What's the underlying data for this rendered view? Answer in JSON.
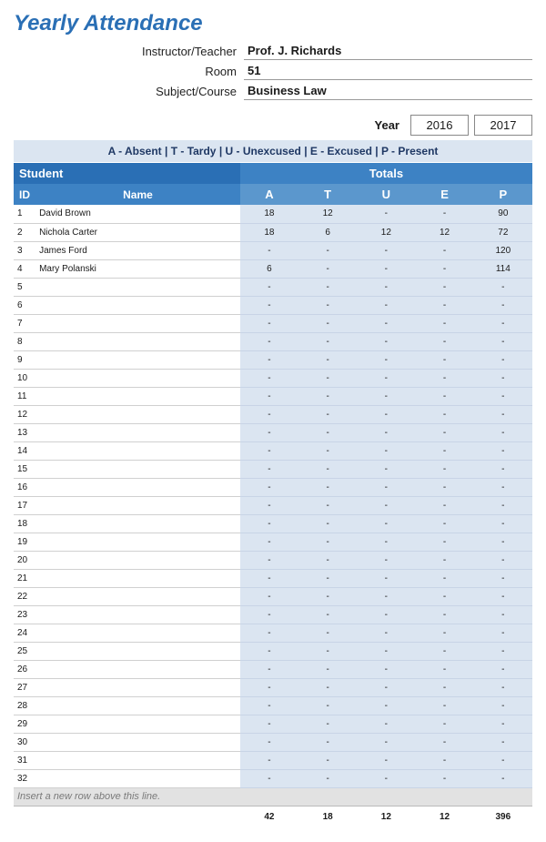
{
  "title": "Yearly Attendance",
  "meta": {
    "instructor_label": "Instructor/Teacher",
    "instructor_value": "Prof. J. Richards",
    "room_label": "Room",
    "room_value": "51",
    "subject_label": "Subject/Course",
    "subject_value": "Business Law"
  },
  "year": {
    "label": "Year",
    "y1": "2016",
    "y2": "2017"
  },
  "legend": "A - Absent  |  T - Tardy  |  U - Unexcused  |  E - Excused  |  P - Present",
  "headers": {
    "student": "Student",
    "totals": "Totals",
    "id": "ID",
    "name": "Name",
    "cols": [
      "A",
      "T",
      "U",
      "E",
      "P"
    ]
  },
  "rows": [
    {
      "id": "1",
      "name": "David Brown",
      "a": "18",
      "t": "12",
      "u": "-",
      "e": "-",
      "p": "90"
    },
    {
      "id": "2",
      "name": "Nichola Carter",
      "a": "18",
      "t": "6",
      "u": "12",
      "e": "12",
      "p": "72"
    },
    {
      "id": "3",
      "name": "James Ford",
      "a": "-",
      "t": "-",
      "u": "-",
      "e": "-",
      "p": "120"
    },
    {
      "id": "4",
      "name": "Mary Polanski",
      "a": "6",
      "t": "-",
      "u": "-",
      "e": "-",
      "p": "114"
    },
    {
      "id": "5",
      "name": "",
      "a": "-",
      "t": "-",
      "u": "-",
      "e": "-",
      "p": "-"
    },
    {
      "id": "6",
      "name": "",
      "a": "-",
      "t": "-",
      "u": "-",
      "e": "-",
      "p": "-"
    },
    {
      "id": "7",
      "name": "",
      "a": "-",
      "t": "-",
      "u": "-",
      "e": "-",
      "p": "-"
    },
    {
      "id": "8",
      "name": "",
      "a": "-",
      "t": "-",
      "u": "-",
      "e": "-",
      "p": "-"
    },
    {
      "id": "9",
      "name": "",
      "a": "-",
      "t": "-",
      "u": "-",
      "e": "-",
      "p": "-"
    },
    {
      "id": "10",
      "name": "",
      "a": "-",
      "t": "-",
      "u": "-",
      "e": "-",
      "p": "-"
    },
    {
      "id": "11",
      "name": "",
      "a": "-",
      "t": "-",
      "u": "-",
      "e": "-",
      "p": "-"
    },
    {
      "id": "12",
      "name": "",
      "a": "-",
      "t": "-",
      "u": "-",
      "e": "-",
      "p": "-"
    },
    {
      "id": "13",
      "name": "",
      "a": "-",
      "t": "-",
      "u": "-",
      "e": "-",
      "p": "-"
    },
    {
      "id": "14",
      "name": "",
      "a": "-",
      "t": "-",
      "u": "-",
      "e": "-",
      "p": "-"
    },
    {
      "id": "15",
      "name": "",
      "a": "-",
      "t": "-",
      "u": "-",
      "e": "-",
      "p": "-"
    },
    {
      "id": "16",
      "name": "",
      "a": "-",
      "t": "-",
      "u": "-",
      "e": "-",
      "p": "-"
    },
    {
      "id": "17",
      "name": "",
      "a": "-",
      "t": "-",
      "u": "-",
      "e": "-",
      "p": "-"
    },
    {
      "id": "18",
      "name": "",
      "a": "-",
      "t": "-",
      "u": "-",
      "e": "-",
      "p": "-"
    },
    {
      "id": "19",
      "name": "",
      "a": "-",
      "t": "-",
      "u": "-",
      "e": "-",
      "p": "-"
    },
    {
      "id": "20",
      "name": "",
      "a": "-",
      "t": "-",
      "u": "-",
      "e": "-",
      "p": "-"
    },
    {
      "id": "21",
      "name": "",
      "a": "-",
      "t": "-",
      "u": "-",
      "e": "-",
      "p": "-"
    },
    {
      "id": "22",
      "name": "",
      "a": "-",
      "t": "-",
      "u": "-",
      "e": "-",
      "p": "-"
    },
    {
      "id": "23",
      "name": "",
      "a": "-",
      "t": "-",
      "u": "-",
      "e": "-",
      "p": "-"
    },
    {
      "id": "24",
      "name": "",
      "a": "-",
      "t": "-",
      "u": "-",
      "e": "-",
      "p": "-"
    },
    {
      "id": "25",
      "name": "",
      "a": "-",
      "t": "-",
      "u": "-",
      "e": "-",
      "p": "-"
    },
    {
      "id": "26",
      "name": "",
      "a": "-",
      "t": "-",
      "u": "-",
      "e": "-",
      "p": "-"
    },
    {
      "id": "27",
      "name": "",
      "a": "-",
      "t": "-",
      "u": "-",
      "e": "-",
      "p": "-"
    },
    {
      "id": "28",
      "name": "",
      "a": "-",
      "t": "-",
      "u": "-",
      "e": "-",
      "p": "-"
    },
    {
      "id": "29",
      "name": "",
      "a": "-",
      "t": "-",
      "u": "-",
      "e": "-",
      "p": "-"
    },
    {
      "id": "30",
      "name": "",
      "a": "-",
      "t": "-",
      "u": "-",
      "e": "-",
      "p": "-"
    },
    {
      "id": "31",
      "name": "",
      "a": "-",
      "t": "-",
      "u": "-",
      "e": "-",
      "p": "-"
    },
    {
      "id": "32",
      "name": "",
      "a": "-",
      "t": "-",
      "u": "-",
      "e": "-",
      "p": "-"
    }
  ],
  "insert_hint": "Insert a new row above this line.",
  "grand_totals": {
    "a": "42",
    "t": "18",
    "u": "12",
    "e": "12",
    "p": "396"
  }
}
